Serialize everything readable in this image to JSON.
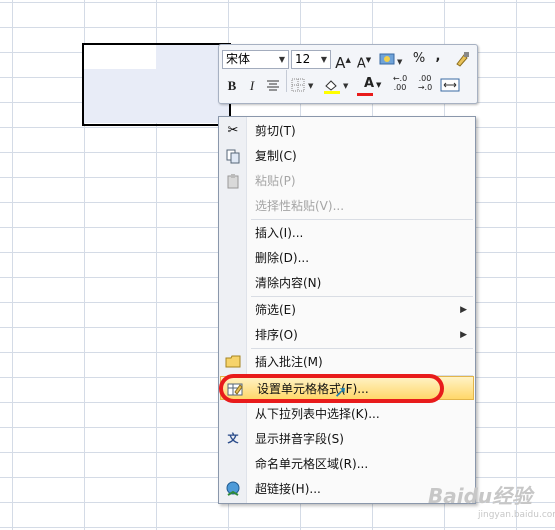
{
  "minitoolbar": {
    "font_name": "宋体",
    "font_size": "12",
    "grow_font": "A",
    "shrink_font": "A",
    "percent": "%",
    "comma": ",",
    "bold": "B",
    "italic": "I",
    "font_color_label": "A",
    "inc_decimal": "←.0\n.00",
    "dec_decimal": ".00\n→.0"
  },
  "menu": {
    "cut": "剪切(T)",
    "copy": "复制(C)",
    "paste": "粘贴(P)",
    "paste_special": "选择性粘贴(V)...",
    "insert": "插入(I)...",
    "delete": "删除(D)...",
    "clear": "清除内容(N)",
    "filter": "筛选(E)",
    "sort": "排序(O)",
    "insert_comment": "插入批注(M)",
    "format_cells": "设置单元格格式(F)...",
    "pick_list": "从下拉列表中选择(K)...",
    "phonetic": "显示拼音字段(S)",
    "name_range": "命名单元格区域(R)...",
    "hyperlink": "超链接(H)..."
  },
  "watermark": {
    "brand": "Baidu经验",
    "url": "jingyan.baidu.com"
  },
  "colors": {
    "highlight_fill": "#fce28a",
    "annotation_red": "#e81b1b"
  }
}
